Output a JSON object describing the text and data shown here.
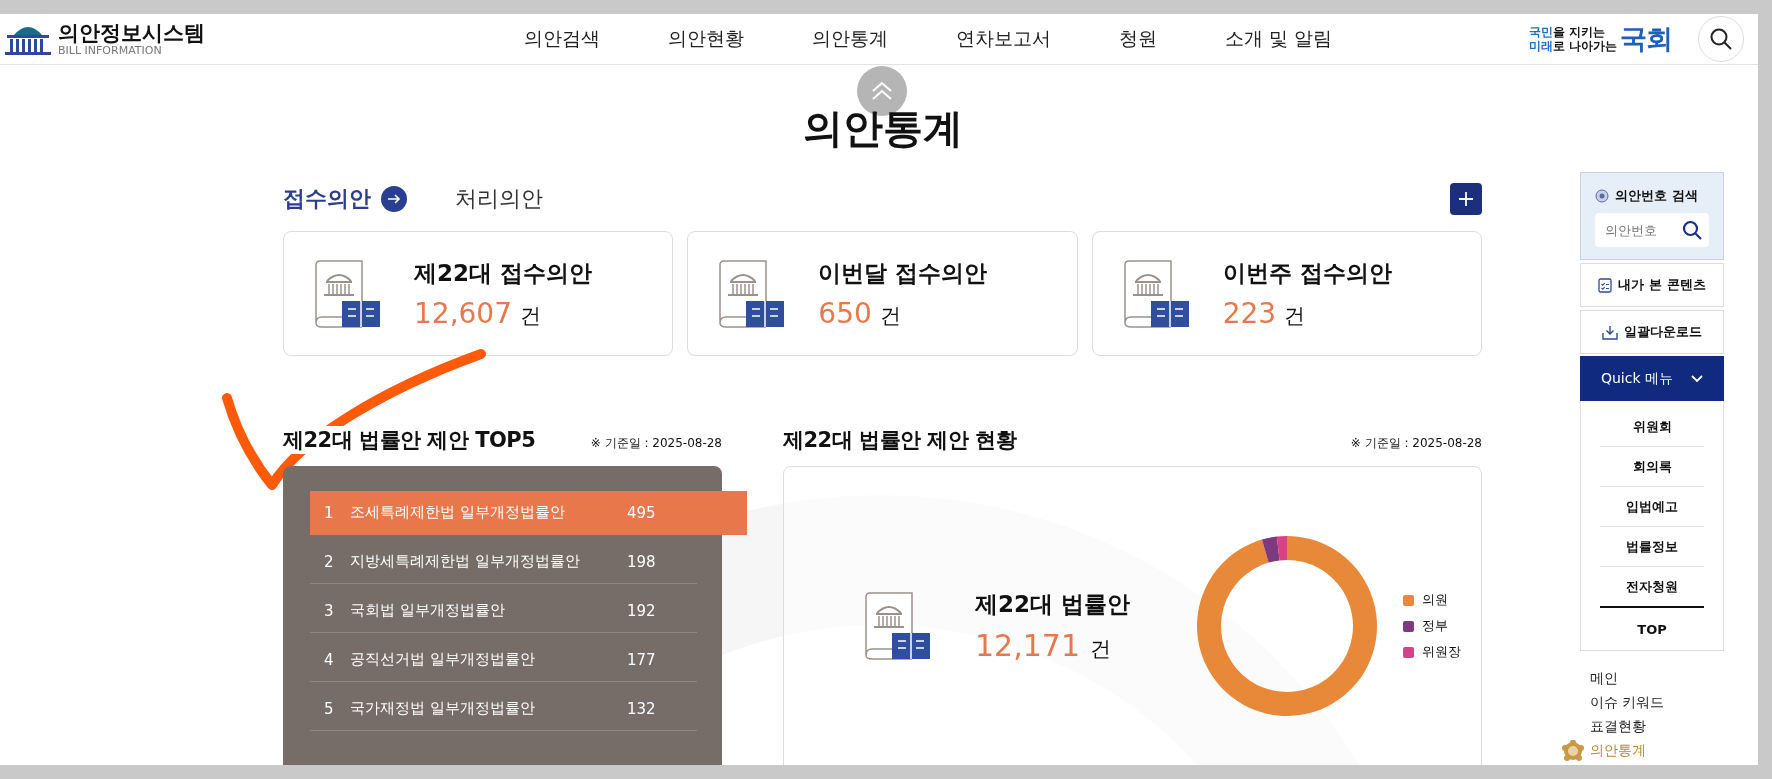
{
  "header": {
    "logo_title": "의안정보시스템",
    "logo_subtitle": "BILL INFORMATION",
    "nav": [
      {
        "label": "의안검색"
      },
      {
        "label": "의안현황"
      },
      {
        "label": "의안통계"
      },
      {
        "label": "연차보고서"
      },
      {
        "label": "청원"
      },
      {
        "label": "소개 및 알림"
      }
    ],
    "slogan": [
      {
        "accent": "국민",
        "rest": "을 지키는"
      },
      {
        "accent": "미래",
        "rest": "로 나아가는"
      }
    ],
    "brand": "국회"
  },
  "page_title": "의안통계",
  "tabs": [
    {
      "label": "접수의안",
      "selected": true
    },
    {
      "label": "처리의안",
      "selected": false
    }
  ],
  "cards": [
    {
      "title": "제22대 접수의안",
      "count": "12,607",
      "unit": "건"
    },
    {
      "title": "이번달 접수의안",
      "count": "650",
      "unit": "건"
    },
    {
      "title": "이번주 접수의안",
      "count": "223",
      "unit": "건"
    }
  ],
  "top5": {
    "title": "제22대 법률안 제안 TOP5",
    "date": "※ 기준일 : 2025-08-28",
    "items": [
      {
        "rank": "1",
        "name": "조세특례제한법 일부개정법률안",
        "count": "495",
        "selected": true
      },
      {
        "rank": "2",
        "name": "지방세특례제한법 일부개정법률안",
        "count": "198",
        "selected": false
      },
      {
        "rank": "3",
        "name": "국회법 일부개정법률안",
        "count": "192",
        "selected": false
      },
      {
        "rank": "4",
        "name": "공직선거법 일부개정법률안",
        "count": "177",
        "selected": false
      },
      {
        "rank": "5",
        "name": "국가재정법 일부개정법률안",
        "count": "132",
        "selected": false
      }
    ]
  },
  "status": {
    "title": "제22대 법률안 제안 현황",
    "date": "※ 기준일 : 2025-08-28",
    "label": "제22대 법률안",
    "count": "12,171",
    "unit": "건",
    "legend": [
      {
        "label": "의원",
        "color": "#e8893a"
      },
      {
        "label": "정부",
        "color": "#7d3a80"
      },
      {
        "label": "위원장",
        "color": "#d6418a"
      }
    ]
  },
  "sidebar": {
    "search_title": "의안번호 검색",
    "search_placeholder": "의안번호",
    "buttons": [
      {
        "kind": "history",
        "label": "내가 본 콘텐츠"
      },
      {
        "kind": "download",
        "label": "일괄다운로드"
      }
    ],
    "quick": {
      "label": "Quick 메뉴",
      "expanded": true,
      "items": [
        {
          "label": "위원회",
          "selected": false
        },
        {
          "label": "회의록",
          "selected": false
        },
        {
          "label": "입법예고",
          "selected": false
        },
        {
          "label": "법률정보",
          "selected": false
        },
        {
          "label": "전자청원",
          "selected": true
        }
      ],
      "top": "TOP"
    },
    "links": [
      {
        "label": "메인",
        "selected": false
      },
      {
        "label": "이슈 키워드",
        "selected": false
      },
      {
        "label": "표결현황",
        "selected": false
      },
      {
        "label": "의안통계",
        "selected": true
      }
    ]
  }
}
